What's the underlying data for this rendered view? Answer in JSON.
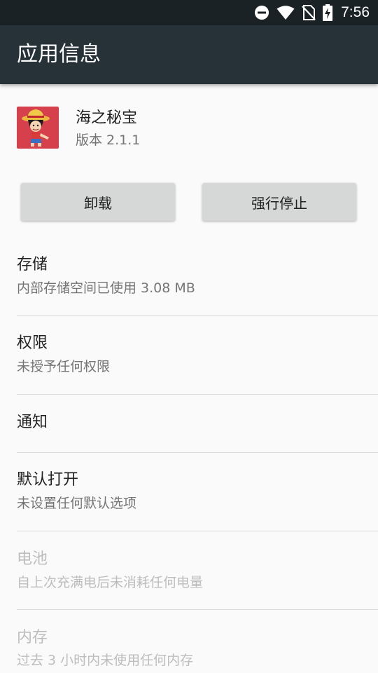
{
  "status_bar": {
    "time": "7:56",
    "icons": [
      "do-not-disturb-icon",
      "wifi-icon",
      "no-sim-icon",
      "battery-charging-icon"
    ]
  },
  "app_bar": {
    "title": "应用信息"
  },
  "app": {
    "name": "海之秘宝",
    "version": "版本 2.1.1",
    "icon": "app-icon-luffy"
  },
  "buttons": {
    "uninstall": "卸载",
    "force_stop": "强行停止"
  },
  "items": [
    {
      "title": "存储",
      "subtitle": "内部存储空间已使用 3.08 MB",
      "enabled": true
    },
    {
      "title": "权限",
      "subtitle": "未授予任何权限",
      "enabled": true
    },
    {
      "title": "通知",
      "subtitle": "",
      "enabled": true
    },
    {
      "title": "默认打开",
      "subtitle": "未设置任何默认选项",
      "enabled": true
    },
    {
      "title": "电池",
      "subtitle": "自上次充满电后未消耗任何电量",
      "enabled": false
    },
    {
      "title": "内存",
      "subtitle": "过去 3 小时内未使用任何内存",
      "enabled": false
    }
  ],
  "colors": {
    "status_bar": "#1b2226",
    "app_bar": "#263238",
    "background": "#fafafa",
    "button": "#d6d7d7",
    "icon_bg": "#d6404c"
  }
}
